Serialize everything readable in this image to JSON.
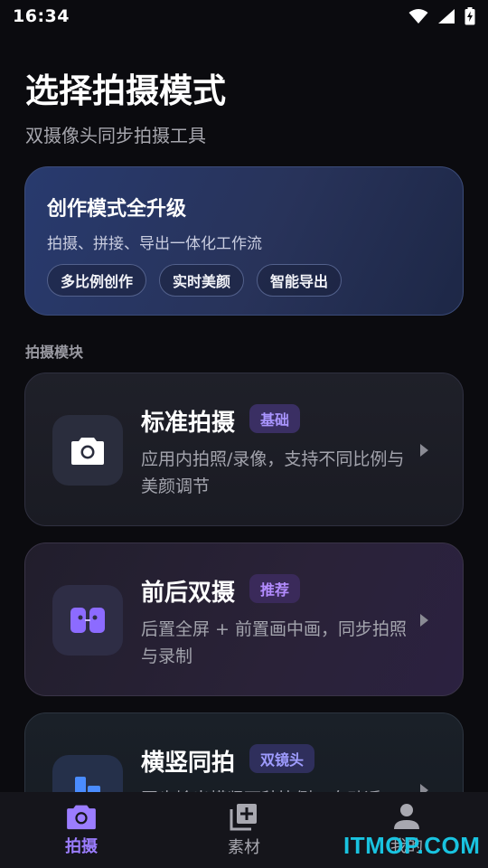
{
  "status_bar": {
    "time": "16:34"
  },
  "header": {
    "title": "选择拍摄模式",
    "subtitle": "双摄像头同步拍摄工具"
  },
  "promo": {
    "title": "创作模式全升级",
    "subtitle": "拍摄、拼接、导出一体化工作流",
    "chips": [
      "多比例创作",
      "实时美颜",
      "智能导出"
    ]
  },
  "section_label": "拍摄模块",
  "modes": [
    {
      "name": "标准拍摄",
      "badge": "基础",
      "description": "应用内拍照/录像，支持不同比例与美颜调节",
      "icon": "camera-icon"
    },
    {
      "name": "前后双摄",
      "badge": "推荐",
      "description": "后置全屏 + 前置画中画，同步拍照与录制",
      "icon": "dual-camera-icon"
    },
    {
      "name": "横竖同拍",
      "badge": "双镜头",
      "description": "同步输出横竖两种比例，自动适",
      "icon": "layout-icon"
    }
  ],
  "bottom_nav": [
    {
      "label": "拍摄",
      "icon": "camera-icon",
      "active": true
    },
    {
      "label": "素材",
      "icon": "add-library-icon",
      "active": false
    },
    {
      "label": "我的",
      "icon": "person-icon",
      "active": false
    }
  ],
  "watermark": "ITMOP.COM",
  "colors": {
    "accent": "#9b7dff",
    "background": "#0b0b0f",
    "promo": "#283a6e",
    "watermark": "#19c3e0"
  }
}
